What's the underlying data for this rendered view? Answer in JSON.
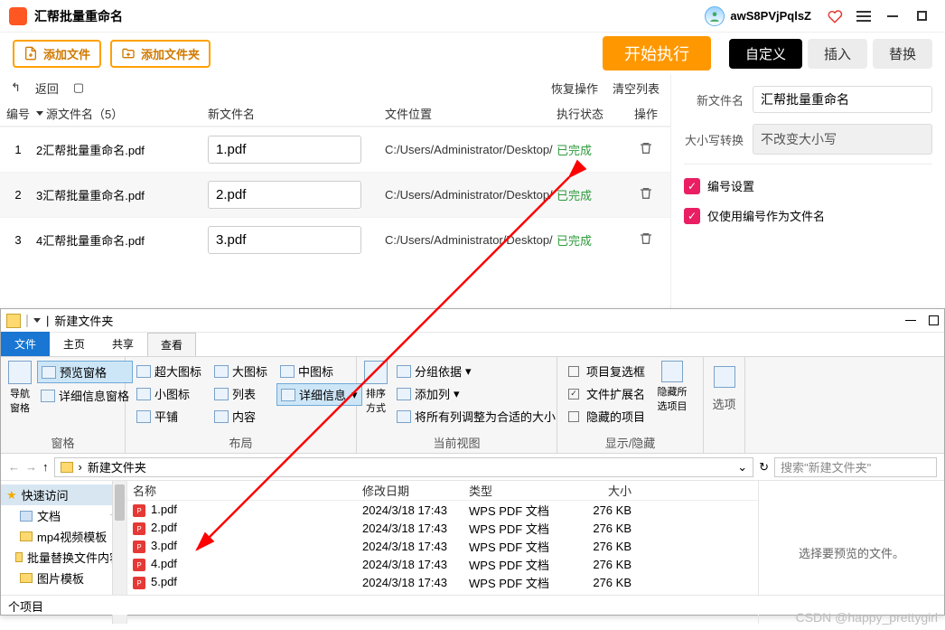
{
  "app": {
    "title": "汇帮批量重命名",
    "user": "awS8PVjPqlsZ"
  },
  "toolbar": {
    "add_file": "添加文件",
    "add_folder": "添加文件夹",
    "start": "开始执行"
  },
  "modes": {
    "custom": "自定义",
    "insert": "插入",
    "replace": "替换"
  },
  "ops": {
    "back": "返回",
    "restore": "恢复操作",
    "clear": "清空列表"
  },
  "table": {
    "headers": {
      "idx": "编号",
      "src": "源文件名（5）",
      "newname": "新文件名",
      "loc": "文件位置",
      "status": "执行状态",
      "action": "操作"
    },
    "rows": [
      {
        "idx": "1",
        "src": "2汇帮批量重命名.pdf",
        "newname": "1.pdf",
        "loc": "C:/Users/Administrator/Desktop/",
        "status": "已完成"
      },
      {
        "idx": "2",
        "src": "3汇帮批量重命名.pdf",
        "newname": "2.pdf",
        "loc": "C:/Users/Administrator/Desktop/",
        "status": "已完成"
      },
      {
        "idx": "3",
        "src": "4汇帮批量重命名.pdf",
        "newname": "3.pdf",
        "loc": "C:/Users/Administrator/Desktop/",
        "status": "已完成"
      }
    ]
  },
  "panel": {
    "new_name_label": "新文件名",
    "new_name_value": "汇帮批量重命名",
    "case_label": "大小写转换",
    "case_value": "不改变大小写",
    "chk_numbering": "编号设置",
    "chk_use_only_number": "仅使用编号作为文件名"
  },
  "explorer": {
    "title": "新建文件夹",
    "tabs": {
      "file": "文件",
      "home": "主页",
      "share": "共享",
      "view": "查看"
    },
    "ribbon": {
      "nav_pane": "导航窗格",
      "preview_pane": "预览窗格",
      "detail_pane": "详细信息窗格",
      "panes": "窗格",
      "xl": "超大图标",
      "l": "大图标",
      "m": "中图标",
      "s": "小图标",
      "list": "列表",
      "details": "详细信息",
      "tiles": "平铺",
      "content": "内容",
      "layout": "布局",
      "sort": "排序方式",
      "group": "分组依据",
      "addcol": "添加列",
      "fitcols": "将所有列调整为合适的大小",
      "current_view": "当前视图",
      "chk_item": "项目复选框",
      "chk_ext": "文件扩展名",
      "chk_hidden": "隐藏的项目",
      "hide_sel": "隐藏所选项目",
      "show_hide": "显示/隐藏",
      "options": "选项"
    },
    "breadcrumb": "新建文件夹",
    "search_placeholder": "搜索\"新建文件夹\"",
    "tree": {
      "quick": "快速访问",
      "docs": "文档",
      "mp4": "mp4视频模板",
      "batch": "批量替换文件内容",
      "pics": "图片模板"
    },
    "columns": {
      "name": "名称",
      "date": "修改日期",
      "type": "类型",
      "size": "大小"
    },
    "files": [
      {
        "name": "1.pdf",
        "date": "2024/3/18 17:43",
        "type": "WPS PDF 文档",
        "size": "276 KB"
      },
      {
        "name": "2.pdf",
        "date": "2024/3/18 17:43",
        "type": "WPS PDF 文档",
        "size": "276 KB"
      },
      {
        "name": "3.pdf",
        "date": "2024/3/18 17:43",
        "type": "WPS PDF 文档",
        "size": "276 KB"
      },
      {
        "name": "4.pdf",
        "date": "2024/3/18 17:43",
        "type": "WPS PDF 文档",
        "size": "276 KB"
      },
      {
        "name": "5.pdf",
        "date": "2024/3/18 17:43",
        "type": "WPS PDF 文档",
        "size": "276 KB"
      }
    ],
    "preview_msg": "选择要预览的文件。",
    "status": "个项目"
  },
  "watermark": "CSDN @happy_prettygirl"
}
